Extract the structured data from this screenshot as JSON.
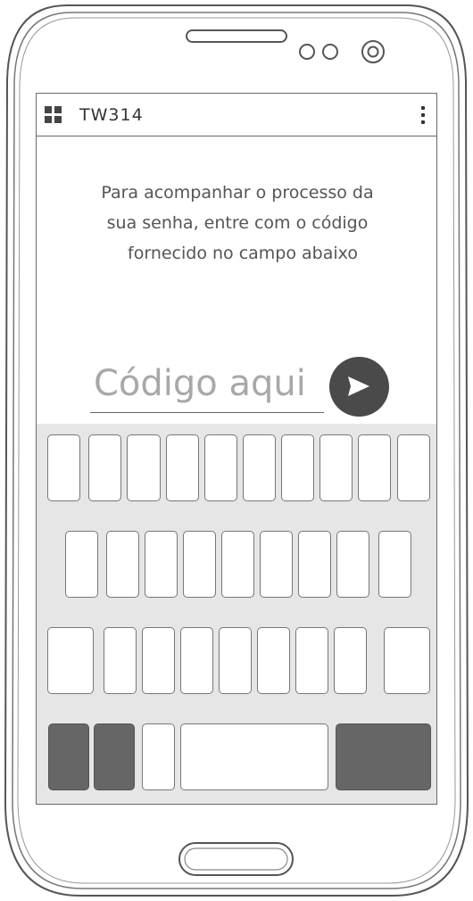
{
  "app_bar": {
    "title": "TW314",
    "apps_icon": "apps-grid-icon",
    "menu_icon": "more-vert-icon"
  },
  "message": {
    "lines": [
      "Para acompanhar o processo da",
      "sua senha, entre com o código",
      "fornecido no campo abaixo"
    ]
  },
  "code_field": {
    "placeholder": "Código aqui",
    "value": ""
  },
  "send_button": {
    "icon": "send-icon"
  },
  "keyboard": {
    "background": "#e6e6e6",
    "row_counts": [
      10,
      9,
      9,
      5
    ]
  },
  "colors": {
    "accent_dark": "#4a4a4a",
    "key_dark": "#666666",
    "outline": "#6a6a6a"
  }
}
